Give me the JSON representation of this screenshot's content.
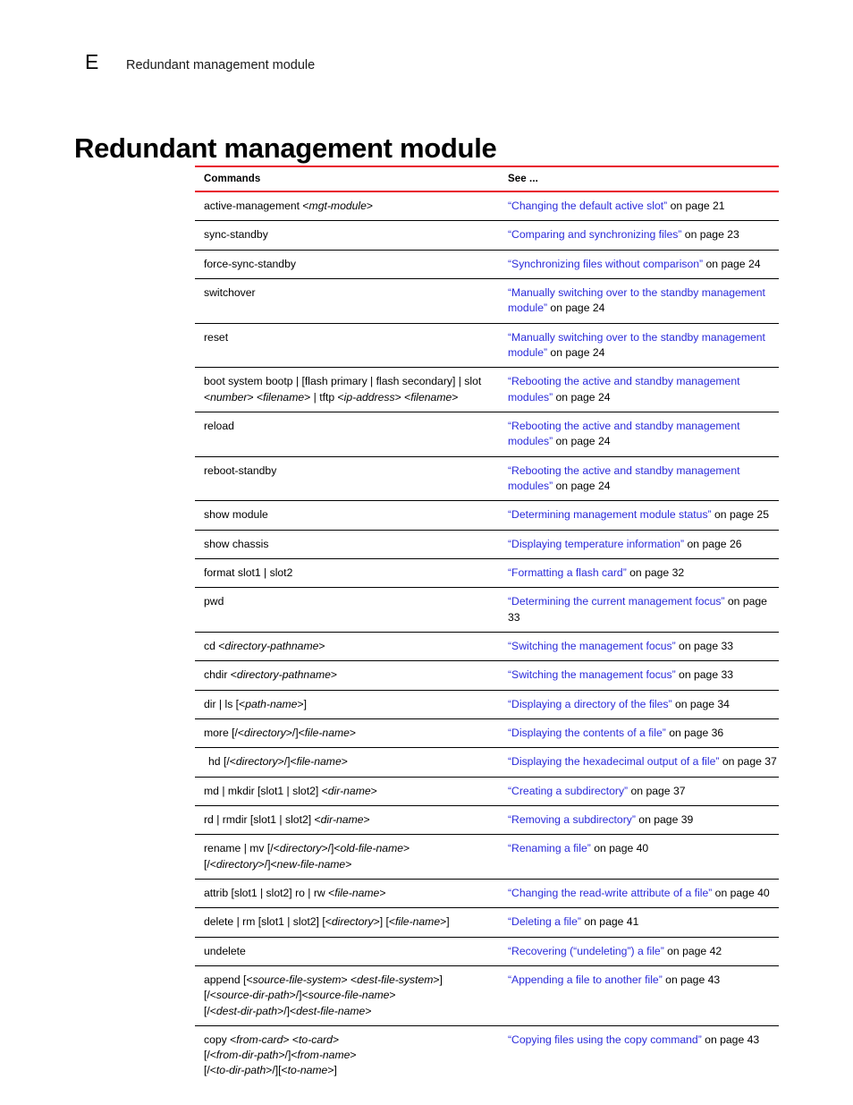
{
  "header": {
    "appendix_letter": "E",
    "title": "Redundant management module"
  },
  "chapter_title": "Redundant management module",
  "table": {
    "columns": [
      "Commands",
      "See ..."
    ],
    "accent_color": "#e8112d",
    "link_color": "#2b2bdb",
    "rows": [
      {
        "command": "active-management <mgt-module>",
        "command_html": "active-management &lt;<i>mgt-module</i>&gt;",
        "see_link": "“Changing the default active slot”",
        "see_tail": " on page 21"
      },
      {
        "command": "sync-standby",
        "command_html": "sync-standby",
        "see_link": "“Comparing and synchronizing files”",
        "see_tail": " on page 23"
      },
      {
        "command": "force-sync-standby",
        "command_html": "force-sync-standby",
        "see_link": "“Synchronizing files without comparison”",
        "see_tail": " on page 24"
      },
      {
        "command": "switchover",
        "command_html": "switchover",
        "see_link": "“Manually switching over to the standby management module”",
        "see_tail": " on page 24"
      },
      {
        "command": "reset",
        "command_html": "reset",
        "see_link": "“Manually switching over to the standby management module”",
        "see_tail": " on page 24"
      },
      {
        "command": "boot system bootp | [flash primary | flash secondary] | slot <number> <filename> | tftp <ip-address> <filename>",
        "command_html": "boot system bootp | [flash primary | flash secondary] | slot &lt;<i>number</i>&gt; &lt;<i>filename</i>&gt; | tftp &lt;<i>ip-address</i>&gt; &lt;<i>filename</i>&gt;",
        "see_link": "“Rebooting the active and standby management modules”",
        "see_tail": " on page 24"
      },
      {
        "command": "reload",
        "command_html": "reload",
        "see_link": "“Rebooting the active and standby management modules”",
        "see_tail": " on page 24"
      },
      {
        "command": "reboot-standby",
        "command_html": "reboot-standby",
        "see_link": "“Rebooting the active and standby management modules”",
        "see_tail": " on page 24"
      },
      {
        "command": "show module",
        "command_html": "show module",
        "see_link": "“Determining management module status”",
        "see_tail": " on page 25"
      },
      {
        "command": "show chassis",
        "command_html": "show chassis",
        "see_link": "“Displaying temperature information”",
        "see_tail": " on page 26"
      },
      {
        "command": "format slot1 | slot2",
        "command_html": "format slot1 | slot2",
        "see_link": "“Formatting a flash card”",
        "see_tail": " on page 32"
      },
      {
        "command": "pwd",
        "command_html": "pwd",
        "see_link": "“Determining the current management focus”",
        "see_tail": " on page 33"
      },
      {
        "command": "cd <directory-pathname>",
        "command_html": "cd &lt;<i>directory-pathname</i>&gt;",
        "see_link": "“Switching the management focus”",
        "see_tail": " on page 33"
      },
      {
        "command": "chdir <directory-pathname>",
        "command_html": "chdir &lt;<i>directory-pathname</i>&gt;",
        "see_link": "“Switching the management focus”",
        "see_tail": " on page 33"
      },
      {
        "command": "dir | ls [<path-name>]",
        "command_html": "dir | ls [&lt;<i>path-name</i>&gt;]",
        "see_link": "“Displaying a directory of the files”",
        "see_tail": " on page 34"
      },
      {
        "command": "more [/<directory>/]<file-name>",
        "command_html": "more [/&lt;<i>directory</i>&gt;/]&lt;<i>file-name</i>&gt;",
        "see_link": "“Displaying the contents of a file”",
        "see_tail": " on page 36"
      },
      {
        "command": "hd [/<directory>/]<file-name>",
        "command_html": "hd [/&lt;<i>directory</i>&gt;/]&lt;<i>file-name</i>&gt;",
        "indented": true,
        "see_link": "“Displaying the hexadecimal output of a file”",
        "see_tail": " on page 37"
      },
      {
        "command": "md | mkdir [slot1 | slot2] <dir-name>",
        "command_html": "md | mkdir [slot1 | slot2] &lt;<i>dir-name</i>&gt;",
        "see_link": "“Creating a subdirectory”",
        "see_tail": " on page 37"
      },
      {
        "command": "rd | rmdir [slot1 | slot2] <dir-name>",
        "command_html": "rd | rmdir [slot1 | slot2] &lt;<i>dir-name</i>&gt;",
        "see_link": "“Removing a subdirectory”",
        "see_tail": " on page 39"
      },
      {
        "command": "rename | mv [/<directory>/]<old-file-name> [/<directory>/]<new-file-name>",
        "command_html": "rename | mv [/&lt;<i>directory</i>&gt;/]&lt;<i>old-file-name</i>&gt;<br>[/&lt;<i>directory</i>&gt;/]&lt;<i>new-file-name</i>&gt;",
        "see_link": "“Renaming a file”",
        "see_tail": " on page 40"
      },
      {
        "command": "attrib [slot1 | slot2] ro | rw <file-name>",
        "command_html": "attrib [slot1 | slot2] ro | rw &lt;<i>file-name</i>&gt;",
        "see_link": "“Changing the read-write attribute of a file”",
        "see_tail": " on page 40"
      },
      {
        "command": "delete | rm [slot1 | slot2] [<directory>] [<file-name>]",
        "command_html": "delete | rm [slot1 | slot2] [&lt;<i>directory</i>&gt;] [&lt;<i>file-name</i>&gt;]",
        "see_link": "“Deleting a file”",
        "see_tail": " on page 41"
      },
      {
        "command": "undelete",
        "command_html": "undelete",
        "see_link": "“Recovering (“undeleting”) a file”",
        "see_tail": " on page 42"
      },
      {
        "command": "append [<source-file-system> <dest-file-system>] [/<source-dir-path>/]<source-file-name> [/<dest-dir-path>/]<dest-file-name>",
        "command_html": "append [&lt;<i>source-file-system</i>&gt; &lt;<i>dest-file-system</i>&gt;]<br>[/&lt;<i>source-dir-path</i>&gt;/]&lt;<i>source-file-name</i>&gt;<br>[/&lt;<i>dest-dir-path</i>&gt;/]&lt;<i>dest-file-name</i>&gt;",
        "see_link": "“Appending a file to another file”",
        "see_tail": " on page 43"
      },
      {
        "command": "copy <from-card> <to-card> [/<from-dir-path>/]<from-name> [/<to-dir-path>/][<to-name>]",
        "command_html": "copy &lt;<i>from-card</i>&gt; &lt;<i>to-card</i>&gt;<br>[/&lt;<i>from-dir-path</i>&gt;/]&lt;<i>from-name</i>&gt;<br>[/&lt;<i>to-dir-path</i>&gt;/][&lt;<i>to-name</i>&gt;]",
        "see_link": "“Copying files using the copy command”",
        "see_tail": " on page 43"
      }
    ]
  }
}
